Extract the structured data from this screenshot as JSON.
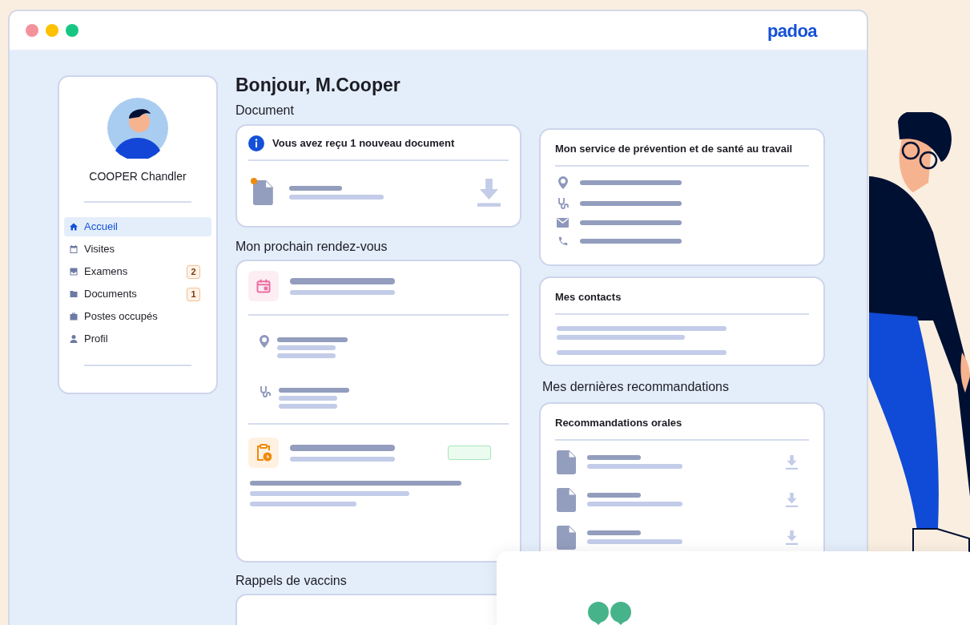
{
  "window": {
    "logo": "padoa"
  },
  "sidebar": {
    "user_name": "COOPER Chandler",
    "items": [
      {
        "label": "Accueil",
        "selected": true
      },
      {
        "label": "Visites",
        "selected": false
      },
      {
        "label": "Examens",
        "selected": false,
        "badge": "2"
      },
      {
        "label": "Documents",
        "selected": false,
        "badge": "1"
      },
      {
        "label": "Postes occupés",
        "selected": false
      },
      {
        "label": "Profil",
        "selected": false
      }
    ]
  },
  "greeting": "Bonjour, M.Cooper",
  "document": {
    "heading": "Document",
    "notice": "Vous avez reçu 1 nouveau document",
    "unread": true
  },
  "appointment": {
    "heading": "Mon prochain rendez-vous"
  },
  "vaccines": {
    "heading": "Rappels de vaccins"
  },
  "service": {
    "title": "Mon service de prévention et de santé au travail"
  },
  "contacts": {
    "title": "Mes contacts"
  },
  "recommendations": {
    "heading": "Mes dernières recommandations",
    "card_title": "Recommandations orales"
  }
}
